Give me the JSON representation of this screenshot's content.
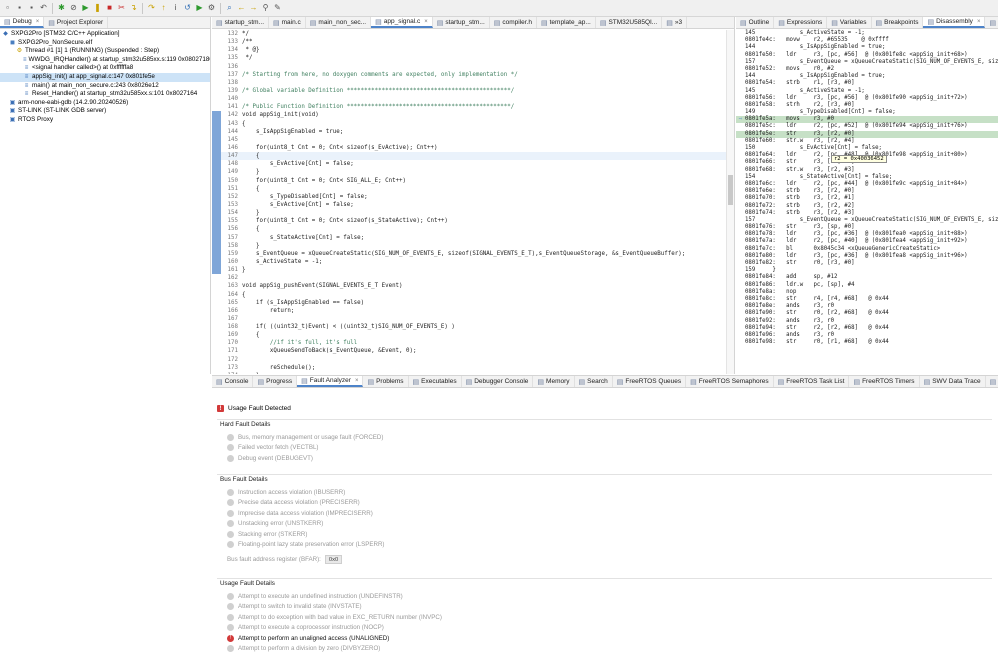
{
  "toolbar": {
    "icons": [
      "new-icon",
      "save-icon",
      "save-all-icon",
      "undo-icon",
      "debug-icon",
      "skip-breakpoints-icon",
      "resume-icon",
      "suspend-icon",
      "terminate-icon",
      "disconnect-icon",
      "step-into-icon",
      "step-over-icon",
      "step-return-icon",
      "instruction-step-icon",
      "reset-icon",
      "run-icon",
      "external-tools-icon",
      "search-icon",
      "back-icon",
      "forward-icon",
      "pin-icon",
      "navigate-icon"
    ]
  },
  "debug_panel": {
    "tabs": [
      {
        "label": "Debug",
        "icon": "bug-icon",
        "active": true
      },
      {
        "label": "Project Explorer",
        "icon": "folder-icon",
        "active": false
      }
    ],
    "tree": [
      {
        "indent": 0,
        "icon": "c-app-icon",
        "label": "SXPG2Pro [STM32 C/C++ Application]"
      },
      {
        "indent": 1,
        "icon": "elf-icon",
        "label": "SXPG2Pro_NonSecure.elf"
      },
      {
        "indent": 2,
        "icon": "thread-icon",
        "label": "Thread #1 [1] 1 (RUNNING) (Suspended : Step)"
      },
      {
        "indent": 3,
        "icon": "frame-icon",
        "label": "WWDG_IRQHandler() at startup_stm32u585xx.s:119 0x08027180"
      },
      {
        "indent": 3,
        "icon": "frame-icon",
        "label": "<signal handler called>() at 0xffffffa8"
      },
      {
        "indent": 3,
        "icon": "frame-icon",
        "label": "appSig_init() at app_signal.c:147 0x801fe5e",
        "selected": true
      },
      {
        "indent": 3,
        "icon": "frame-icon",
        "label": "main() at main_non_secure.c:243 0x8026e12"
      },
      {
        "indent": 3,
        "icon": "frame-icon",
        "label": "Reset_Handler() at startup_stm32u585xx.s:101 0x8027164"
      },
      {
        "indent": 1,
        "icon": "gdb-icon",
        "label": "arm-none-eabi-gdb (14.2.90.20240526)"
      },
      {
        "indent": 1,
        "icon": "gdb-icon",
        "label": "ST-LINK (ST-LINK GDB server)"
      },
      {
        "indent": 1,
        "icon": "gdb-icon",
        "label": "RTOS Proxy"
      }
    ]
  },
  "editor": {
    "tabs": [
      {
        "label": "startup_stm...",
        "active": false
      },
      {
        "label": "main.c",
        "active": false
      },
      {
        "label": "main_non_sec...",
        "active": false
      },
      {
        "label": "app_signal.c",
        "active": true
      },
      {
        "label": "startup_stm...",
        "active": false
      },
      {
        "label": "compiler.h",
        "active": false
      },
      {
        "label": "template_ap...",
        "active": false
      },
      {
        "label": "STM32U585QI...",
        "active": false
      },
      {
        "label": "»3",
        "active": false
      }
    ],
    "lines": [
      {
        "n": "132",
        "t": "*/"
      },
      {
        "n": "133",
        "t": "/**"
      },
      {
        "n": "134",
        "t": " * @}"
      },
      {
        "n": "135",
        "t": " */"
      },
      {
        "n": "136",
        "t": ""
      },
      {
        "n": "137",
        "t": "/* Starting from here, no doxygen comments are expected, only implementation */",
        "cm": true
      },
      {
        "n": "138",
        "t": ""
      },
      {
        "n": "139",
        "t": "/* Global variable Definition ***********************************************/",
        "cm": true
      },
      {
        "n": "140",
        "t": ""
      },
      {
        "n": "141",
        "t": "/* Public Function Definition ***********************************************/",
        "cm": true
      },
      {
        "n": "142",
        "t": "void appSig_init(void)",
        "bp": true
      },
      {
        "n": "143",
        "t": "{",
        "bp": true
      },
      {
        "n": "144",
        "t": "    s_IsAppSigEnabled = true;",
        "bp": true
      },
      {
        "n": "145",
        "t": "",
        "bp": true
      },
      {
        "n": "146",
        "t": "    for(uint8_t Cnt = 0; Cnt< sizeof(s_EvActive); Cnt++)",
        "bp": true
      },
      {
        "n": "147",
        "t": "    {",
        "cur": true,
        "bp": true
      },
      {
        "n": "148",
        "t": "        s_EvActive[Cnt] = false;",
        "bp": true
      },
      {
        "n": "149",
        "t": "    }",
        "bp": true
      },
      {
        "n": "150",
        "t": "    for(uint8_t Cnt = 0; Cnt< SIG_ALL_E; Cnt++)",
        "bp": true
      },
      {
        "n": "151",
        "t": "    {",
        "bp": true
      },
      {
        "n": "152",
        "t": "        s_TypeDisabled[Cnt] = false;",
        "bp": true
      },
      {
        "n": "153",
        "t": "        s_EvActive[Cnt] = false;",
        "bp": true
      },
      {
        "n": "154",
        "t": "    }",
        "bp": true
      },
      {
        "n": "155",
        "t": "    for(uint8_t Cnt = 0; Cnt< sizeof(s_StateActive); Cnt++)",
        "bp": true
      },
      {
        "n": "156",
        "t": "    {",
        "bp": true
      },
      {
        "n": "157",
        "t": "        s_StateActive[Cnt] = false;",
        "bp": true
      },
      {
        "n": "158",
        "t": "    }",
        "bp": true
      },
      {
        "n": "159",
        "t": "    s_EventQueue = xQueueCreateStatic(SIG_NUM_OF_EVENTS_E, sizeof(SIGNAL_EVENTS_E_T),s_EventQueueStorage, &s_EventQueueBuffer);",
        "bp": true
      },
      {
        "n": "160",
        "t": "    s_ActiveState = -1;",
        "bp": true
      },
      {
        "n": "161",
        "t": "}",
        "bp": true
      },
      {
        "n": "162",
        "t": ""
      },
      {
        "n": "163",
        "t": "void appSig_pushEvent(SIGNAL_EVENTS_E_T Event)"
      },
      {
        "n": "164",
        "t": "{"
      },
      {
        "n": "165",
        "t": "    if (s_IsAppSigEnabled == false)"
      },
      {
        "n": "166",
        "t": "        return;"
      },
      {
        "n": "167",
        "t": ""
      },
      {
        "n": "168",
        "t": "    if( ((uint32_t)Event) < ((uint32_t)SIG_NUM_OF_EVENTS_E) )"
      },
      {
        "n": "169",
        "t": "    {"
      },
      {
        "n": "170",
        "t": "        //if it's full, it's full",
        "cm": true
      },
      {
        "n": "171",
        "t": "        xQueueSendToBack(s_EventQueue, &Event, 0);"
      },
      {
        "n": "172",
        "t": ""
      },
      {
        "n": "173",
        "t": "        reSchedule();"
      },
      {
        "n": "174",
        "t": "    }"
      },
      {
        "n": "175",
        "t": "}"
      },
      {
        "n": "176",
        "t": ""
      }
    ]
  },
  "disasm_panel": {
    "tabs": [
      {
        "label": "Outline",
        "active": false
      },
      {
        "label": "Expressions",
        "active": false
      },
      {
        "label": "Variables",
        "active": false
      },
      {
        "label": "Breakpoints",
        "active": false
      },
      {
        "label": "Disassembly",
        "active": true
      },
      {
        "label": "Registers",
        "active": false
      }
    ],
    "lines": [
      {
        "m": "",
        "t": "145             s_ActiveState = -1;"
      },
      {
        "m": "",
        "t": "0801fe4c:   movw    r2, #65535    @ 0xffff"
      },
      {
        "m": "",
        "t": "144             s_IsAppSigEnabled = true;"
      },
      {
        "m": "",
        "t": "0801fe50:   ldr     r3, [pc, #56]  @ (0x801fe8c <appSig_init+68>)"
      },
      {
        "m": "",
        "t": "157             s_EventQueue = xQueueCreateStatic(SIG_NUM_OF_EVENTS_E, sizeof"
      },
      {
        "m": "",
        "t": "0801fe52:   movs    r0, #2"
      },
      {
        "m": "",
        "t": "144             s_IsAppSigEnabled = true;"
      },
      {
        "m": "",
        "t": "0801fe54:   strb    r1, [r3, #0]"
      },
      {
        "m": "",
        "t": "145             s_ActiveState = -1;"
      },
      {
        "m": "",
        "t": "0801fe56:   ldr     r3, [pc, #56]  @ (0x801fe90 <appSig_init+72>)"
      },
      {
        "m": "",
        "t": "0801fe58:   strh    r2, [r3, #0]"
      },
      {
        "m": "",
        "t": "149             s_TypeDisabled[Cnt] = false;"
      },
      {
        "m": "⇨",
        "t": "0801fe5a:   movs    r3, #0",
        "cur": true
      },
      {
        "m": "",
        "t": "0801fe5c:   ldr     r2, [pc, #52]  @ (0x801fe94 <appSig_init+76>)"
      },
      {
        "m": "",
        "t": "0801fe5e:   str     r3, [r2, #0]",
        "cur": true
      },
      {
        "m": "",
        "t": "0801fe60:   str.w   r3, [r2, #4]"
      },
      {
        "m": "",
        "t": "150             s_EvActive[Cnt] = false;"
      },
      {
        "m": "",
        "t": "0801fe64:   ldr     r2, [pc, #48]  @ (0x801fe98 <appSig_init+80>)"
      },
      {
        "m": "",
        "t": "0801fe66:   str     r3, [r2, #0]"
      },
      {
        "m": "",
        "t": "0801fe68:   str.w   r3, [r2, #3]"
      },
      {
        "m": "",
        "t": "154             s_StateActive[Cnt] = false;"
      },
      {
        "m": "",
        "t": "0801fe6c:   ldr     r2, [pc, #44]  @ (0x801fe9c <appSig_init+84>)"
      },
      {
        "m": "",
        "t": "0801fe6e:   strb    r3, [r2, #0]"
      },
      {
        "m": "",
        "t": "0801fe70:   strb    r3, [r2, #1]"
      },
      {
        "m": "",
        "t": "0801fe72:   strb    r3, [r2, #2]"
      },
      {
        "m": "",
        "t": "0801fe74:   strb    r3, [r2, #3]"
      },
      {
        "m": "",
        "t": "157             s_EventQueue = xQueueCreateStatic(SIG_NUM_OF_EVENTS_E, sizeof"
      },
      {
        "m": "",
        "t": "0801fe76:   str     r3, [sp, #0]"
      },
      {
        "m": "",
        "t": "0801fe78:   ldr     r3, [pc, #36]  @ (0x801fea0 <appSig_init+88>)"
      },
      {
        "m": "",
        "t": "0801fe7a:   ldr     r2, [pc, #40]  @ (0x801fea4 <appSig_init+92>)"
      },
      {
        "m": "",
        "t": "0801fe7c:   bl      0x8045c34 <xQueueGenericCreateStatic>"
      },
      {
        "m": "",
        "t": "0801fe80:   ldr     r3, [pc, #36]  @ (0x801fea8 <appSig_init+96>)"
      },
      {
        "m": "",
        "t": "0801fe82:   str     r0, [r3, #0]"
      },
      {
        "m": "",
        "t": "159     }"
      },
      {
        "m": "",
        "t": "0801fe84:   add     sp, #12"
      },
      {
        "m": "",
        "t": "0801fe86:   ldr.w   pc, [sp], #4"
      },
      {
        "m": "",
        "t": "0801fe8a:   nop"
      },
      {
        "m": "",
        "t": "0801fe8c:   str     r4, [r4, #68]   @ 0x44"
      },
      {
        "m": "",
        "t": "0801fe8e:   ands    r3, r0"
      },
      {
        "m": "",
        "t": "0801fe90:   str     r0, [r2, #68]   @ 0x44"
      },
      {
        "m": "",
        "t": "0801fe92:   ands    r3, r0"
      },
      {
        "m": "",
        "t": "0801fe94:   str     r2, [r2, #68]   @ 0x44"
      },
      {
        "m": "",
        "t": "0801fe96:   ands    r3, r0"
      },
      {
        "m": "",
        "t": "0801fe98:   str     r0, [r1, #68]   @ 0x44"
      }
    ],
    "tooltip": "r2 = 0x40036452"
  },
  "fault_panel": {
    "tabs": [
      {
        "label": "Console",
        "active": false
      },
      {
        "label": "Progress",
        "active": false
      },
      {
        "label": "Fault Analyzer",
        "active": true
      },
      {
        "label": "Problems",
        "active": false
      },
      {
        "label": "Executables",
        "active": false
      },
      {
        "label": "Debugger Console",
        "active": false
      },
      {
        "label": "Memory",
        "active": false
      },
      {
        "label": "Search",
        "active": false
      },
      {
        "label": "FreeRTOS Queues",
        "active": false
      },
      {
        "label": "FreeRTOS Semaphores",
        "active": false
      },
      {
        "label": "FreeRTOS Task List",
        "active": false
      },
      {
        "label": "FreeRTOS Timers",
        "active": false
      },
      {
        "label": "SWV Data Trace",
        "active": false
      },
      {
        "label": "Build Analyzer",
        "active": false
      },
      {
        "label": "C/C++ Unit",
        "active": false
      }
    ],
    "header": "Usage Fault Detected",
    "hard_fault": {
      "title": "Hard Fault Details",
      "items": [
        {
          "label": "Bus, memory management or usage fault (FORCED)",
          "active": false
        },
        {
          "label": "Failed vector fetch (VECTBL)",
          "active": false
        },
        {
          "label": "Debug event (DEBUGEVT)",
          "active": false
        }
      ]
    },
    "bus_fault": {
      "title": "Bus Fault Details",
      "items": [
        {
          "label": "Instruction access violation (IBUSERR)",
          "active": false
        },
        {
          "label": "Precise data access violation (PRECISERR)",
          "active": false
        },
        {
          "label": "Imprecise data access violation (IMPRECISERR)",
          "active": false
        },
        {
          "label": "Unstacking error (UNSTKERR)",
          "active": false
        },
        {
          "label": "Stacking error (STKERR)",
          "active": false
        },
        {
          "label": "Floating-point lazy state preservation error (LSPERR)",
          "active": false
        }
      ],
      "bfar_label": "Bus fault address register (BFAR):",
      "bfar_value": "0x0"
    },
    "usage_fault": {
      "title": "Usage Fault Details",
      "items": [
        {
          "label": "Attempt to execute an undefined instruction (UNDEFINSTR)",
          "active": false
        },
        {
          "label": "Attempt to switch to invalid state (INVSTATE)",
          "active": false
        },
        {
          "label": "Attempt to do exception with bad value in EXC_RETURN number (INVPC)",
          "active": false
        },
        {
          "label": "Attempt to execute a coprocessor instruction (NOCP)",
          "active": false
        },
        {
          "label": "Attempt to perform an unaligned access (UNALIGNED)",
          "active": true
        },
        {
          "label": "Attempt to perform a division by zero (DIVBYZERO)",
          "active": false
        }
      ]
    }
  }
}
